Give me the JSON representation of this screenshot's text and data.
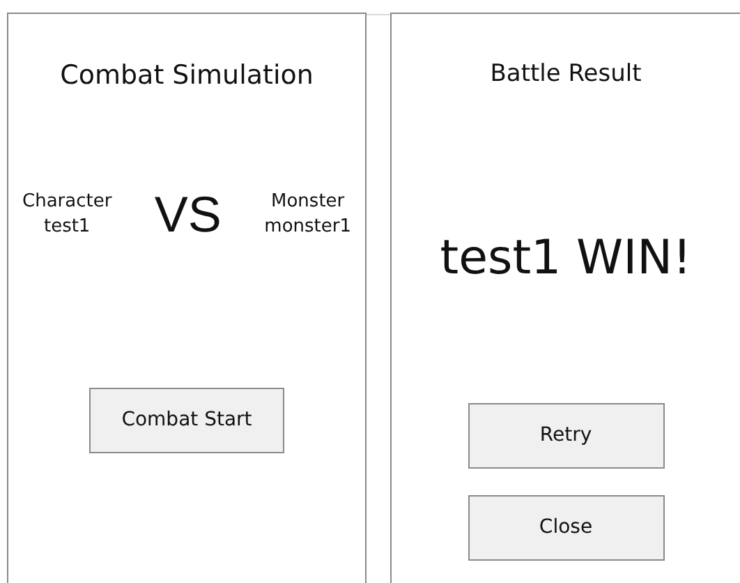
{
  "combat_window": {
    "title": "Combat Simulation",
    "character": {
      "label": "Character",
      "name": "test1"
    },
    "versus": "VS",
    "monster": {
      "label": "Monster",
      "name": "monster1"
    },
    "start_button": "Combat Start"
  },
  "result_window": {
    "title": "Battle Result",
    "result": "test1 WIN!",
    "buttons": [
      "Retry",
      "Close"
    ]
  }
}
